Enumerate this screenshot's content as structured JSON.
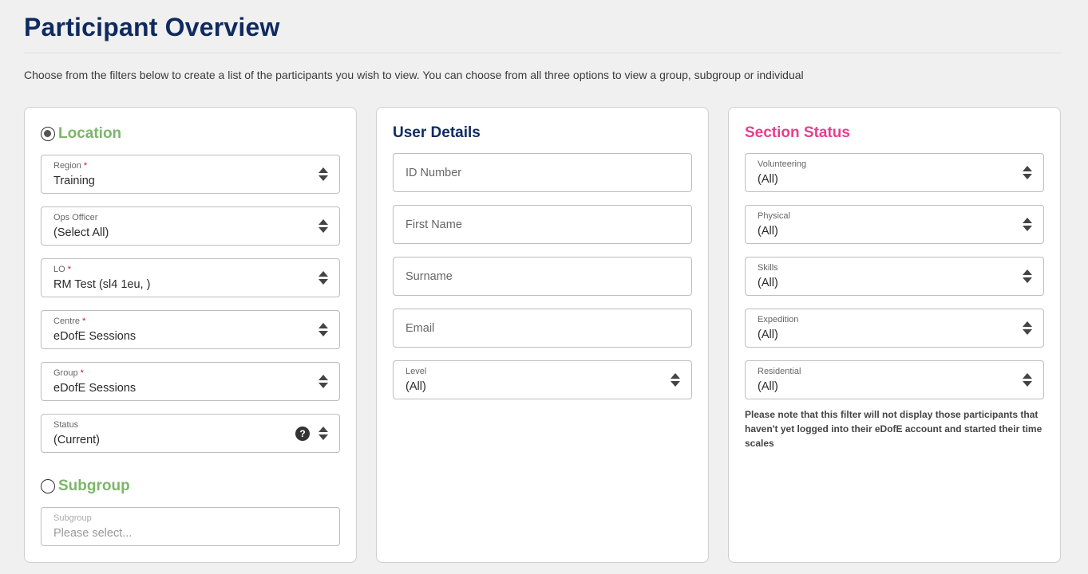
{
  "page": {
    "title": "Participant Overview",
    "intro": "Choose from the filters below to create a list of the participants you wish to view. You can choose from all three options to view a group, subgroup or individual"
  },
  "location": {
    "heading": "Location",
    "selected": true,
    "fields": [
      {
        "label": "Region",
        "required": "*",
        "value": "Training"
      },
      {
        "label": "Ops Officer",
        "required": "",
        "value": "(Select All)"
      },
      {
        "label": "LO",
        "required": "*",
        "value": "RM Test (sl4 1eu, )"
      },
      {
        "label": "Centre",
        "required": "*",
        "value": "eDofE Sessions"
      },
      {
        "label": "Group",
        "required": "*",
        "value": "eDofE Sessions"
      },
      {
        "label": "Status",
        "required": "",
        "value": "(Current)",
        "help": "?"
      }
    ]
  },
  "subgroup": {
    "heading": "Subgroup",
    "selected": false,
    "field": {
      "label": "Subgroup",
      "placeholder": "Please select..."
    }
  },
  "user_details": {
    "heading": "User Details",
    "inputs": [
      "ID Number",
      "First Name",
      "Surname",
      "Email"
    ],
    "level": {
      "label": "Level",
      "value": "(All)"
    }
  },
  "section_status": {
    "heading": "Section Status",
    "fields": [
      {
        "label": "Volunteering",
        "value": "(All)"
      },
      {
        "label": "Physical",
        "value": "(All)"
      },
      {
        "label": "Skills",
        "value": "(All)"
      },
      {
        "label": "Expedition",
        "value": "(All)"
      },
      {
        "label": "Residential",
        "value": "(All)"
      }
    ],
    "note": "Please note that this filter will not display those participants that haven't yet logged into their eDofE account and started their time scales"
  },
  "colors": {
    "navy": "#0f2a5e",
    "green": "#7cb66a",
    "pink": "#e83e8c",
    "required": "#c8102e"
  }
}
